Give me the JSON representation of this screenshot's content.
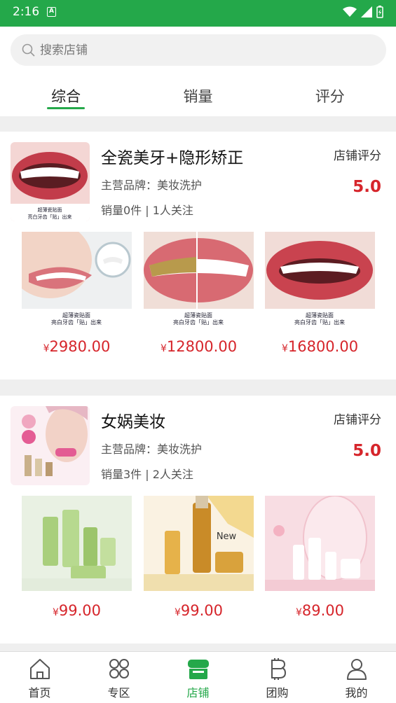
{
  "status_bar": {
    "time": "2:16"
  },
  "search": {
    "placeholder": "搜索店铺"
  },
  "tabs": [
    {
      "label": "综合"
    },
    {
      "label": "销量"
    },
    {
      "label": "评分"
    }
  ],
  "shops": [
    {
      "name": "全瓷美牙+隐形矫正",
      "brand": "主营品牌：美妆洗护",
      "stats": "销量0件 | 1人关注",
      "score_label": "店铺评分",
      "score": "5.0",
      "logo_caption_1": "超薄瓷贴面",
      "logo_caption_2": "亮白牙齿「贴」出来",
      "products": [
        {
          "price": "2980.00",
          "caption_1": "超薄瓷贴面",
          "caption_2": "亮白牙齿「贴」出来"
        },
        {
          "price": "12800.00",
          "caption_1": "超薄瓷贴面",
          "caption_2": "亮白牙齿「贴」出来"
        },
        {
          "price": "16800.00",
          "caption_1": "超薄瓷贴面",
          "caption_2": "亮白牙齿「贴」出来"
        }
      ]
    },
    {
      "name": "女娲美妆",
      "brand": "主营品牌：美妆洗护",
      "stats": "销量3件 | 2人关注",
      "score_label": "店铺评分",
      "score": "5.0",
      "products": [
        {
          "price": "99.00"
        },
        {
          "price": "99.00",
          "badge": "New"
        },
        {
          "price": "89.00"
        }
      ]
    }
  ],
  "currency_symbol": "¥",
  "bottom_nav": [
    {
      "label": "首页",
      "icon": "home-icon"
    },
    {
      "label": "专区",
      "icon": "grid-icon"
    },
    {
      "label": "店铺",
      "icon": "store-icon",
      "active": true
    },
    {
      "label": "团购",
      "icon": "bitcoin-icon"
    },
    {
      "label": "我的",
      "icon": "user-icon"
    }
  ],
  "colors": {
    "brand_green": "#24a84a",
    "price_red": "#d6252b"
  }
}
